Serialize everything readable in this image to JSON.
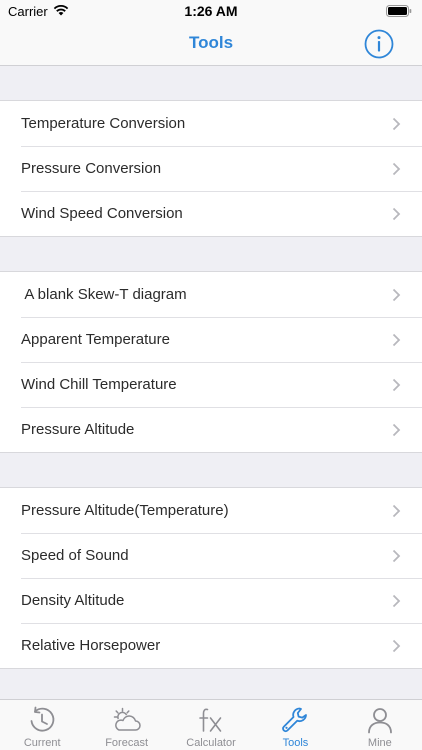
{
  "status_bar": {
    "carrier": "Carrier",
    "time": "1:26 AM",
    "wifi_icon": "wifi-icon",
    "battery_icon": "battery-icon"
  },
  "nav": {
    "title": "Tools",
    "info_icon": "info-icon"
  },
  "colors": {
    "accent": "#2f86d8",
    "inactive": "#8e8e93",
    "background": "#efeff4"
  },
  "sections": [
    {
      "items": [
        {
          "label": "Temperature Conversion"
        },
        {
          "label": "Pressure Conversion"
        },
        {
          "label": "Wind Speed Conversion"
        }
      ]
    },
    {
      "items": [
        {
          "label": " A blank Skew-T diagram"
        },
        {
          "label": "Apparent Temperature"
        },
        {
          "label": "Wind Chill Temperature"
        },
        {
          "label": "Pressure Altitude"
        }
      ]
    },
    {
      "items": [
        {
          "label": "Pressure Altitude(Temperature)"
        },
        {
          "label": "Speed of Sound"
        },
        {
          "label": "Density Altitude"
        },
        {
          "label": "Relative Horsepower"
        }
      ]
    }
  ],
  "tabs": [
    {
      "label": "Current",
      "icon": "clock-refresh-icon",
      "active": false
    },
    {
      "label": "Forecast",
      "icon": "cloud-sun-icon",
      "active": false
    },
    {
      "label": "Calculator",
      "icon": "fx-icon",
      "active": false
    },
    {
      "label": "Tools",
      "icon": "wrench-icon",
      "active": true
    },
    {
      "label": "Mine",
      "icon": "person-icon",
      "active": false
    }
  ]
}
